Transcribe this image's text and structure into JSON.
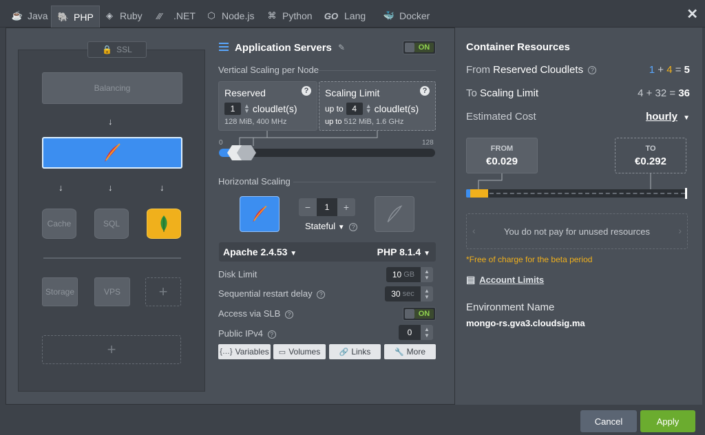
{
  "tabs": [
    {
      "label": "Java",
      "icon": "java-icon"
    },
    {
      "label": "PHP",
      "icon": "php-icon",
      "active": true
    },
    {
      "label": "Ruby",
      "icon": "ruby-icon"
    },
    {
      "label": ".NET",
      "icon": "dotnet-icon"
    },
    {
      "label": "Node.js",
      "icon": "nodejs-icon"
    },
    {
      "label": "Python",
      "icon": "python-icon"
    },
    {
      "label": "Lang",
      "icon": "go-icon",
      "prefix": "GO"
    },
    {
      "label": "Docker",
      "icon": "docker-icon"
    }
  ],
  "topology": {
    "ssl": "SSL",
    "balancing": "Balancing",
    "cache": "Cache",
    "sql": "SQL",
    "storage": "Storage",
    "vps": "VPS",
    "plus": "+"
  },
  "middle": {
    "title": "Application Servers",
    "toggle_on": "ON",
    "vertical_label": "Vertical Scaling per Node",
    "reserved": {
      "title": "Reserved",
      "value": "1",
      "unit": "cloudlet(s)",
      "sub": "128 MiB, 400 MHz"
    },
    "limit": {
      "title": "Scaling Limit",
      "prefix": "up to",
      "value": "4",
      "unit": "cloudlet(s)",
      "sub_prefix": "up to",
      "sub": "512 MiB, 1.6 GHz"
    },
    "slider_min": "0",
    "slider_max": "128",
    "horizontal_label": "Horizontal Scaling",
    "counter": {
      "minus": "−",
      "value": "1",
      "plus": "+"
    },
    "stateful": "Stateful",
    "apache": "Apache 2.4.53",
    "php": "PHP 8.1.4",
    "disk_label": "Disk Limit",
    "disk_value": "10",
    "disk_unit": "GB",
    "restart_label": "Sequential restart delay",
    "restart_value": "30",
    "restart_unit": "sec",
    "slb_label": "Access via SLB",
    "slb_on": "ON",
    "ipv4_label": "Public IPv4",
    "ipv4_value": "0",
    "buttons": {
      "variables": "Variables",
      "volumes": "Volumes",
      "links": "Links",
      "more": "More"
    }
  },
  "right": {
    "title": "Container Resources",
    "from_prefix": "From",
    "from_bold": "Reserved Cloudlets",
    "from_a": "1",
    "from_b": "4",
    "from_total": "5",
    "to_prefix": "To",
    "to_bold": "Scaling Limit",
    "to_expr": "4 + 32 =",
    "to_total": "36",
    "est_label": "Estimated Cost",
    "est_period": "hourly",
    "from_cap": "FROM",
    "from_amt": "€0.029",
    "to_cap": "TO",
    "to_amt": "€0.292",
    "info": "You do not pay for unused resources",
    "beta": "*Free of charge for the beta period",
    "account": "Account Limits",
    "env_label": "Environment Name",
    "env_value": "mongo-rs.gva3.cloudsig.ma"
  },
  "footer": {
    "cancel": "Cancel",
    "apply": "Apply"
  },
  "colors": {
    "accent_blue": "#3c8ef0",
    "accent_green": "#6bac2f",
    "accent_orange": "#f0b01c"
  }
}
